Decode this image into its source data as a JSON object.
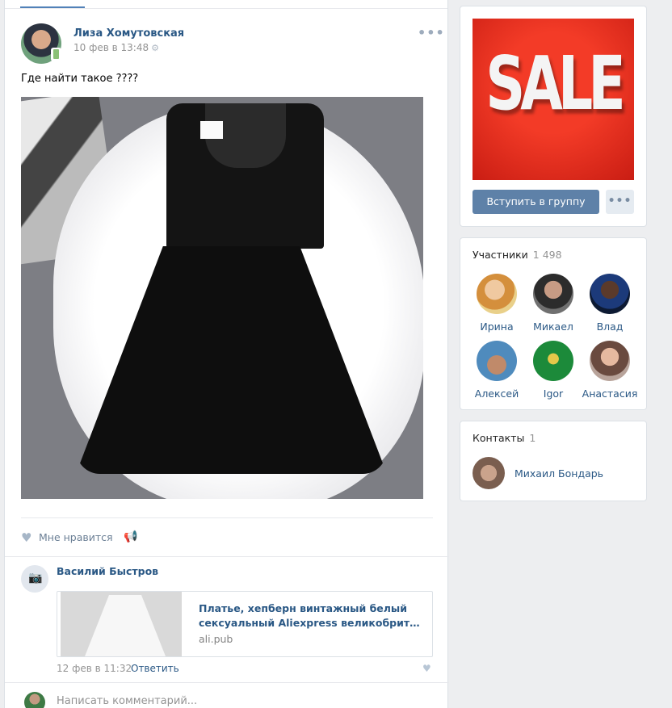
{
  "post": {
    "author": "Лиза Хомутовская",
    "date": "10 фев в 13:48",
    "text": "Где найти такое ????",
    "like_label": "Мне нравится"
  },
  "comment": {
    "author": "Василий Быстров",
    "link_title_line1": "Платье, хепберн винтажный белый",
    "link_title_line2": "сексуальный Aliexpress великобритании лет...",
    "link_domain": "ali.pub",
    "date": "12 фев в 11:32",
    "reply_label": "Ответить",
    "write_placeholder": "Написать комментарий..."
  },
  "group": {
    "cover_text": "SALE",
    "join_label": "Вступить в группу",
    "more_label": "•••"
  },
  "members": {
    "title": "Участники",
    "count": "1 498",
    "items": [
      {
        "name": "Ирина"
      },
      {
        "name": "Микаел"
      },
      {
        "name": "Влад"
      },
      {
        "name": "Алексей"
      },
      {
        "name": "Igor"
      },
      {
        "name": "Анастасия"
      }
    ]
  },
  "contacts": {
    "title": "Контакты",
    "count": "1",
    "items": [
      {
        "name": "Михаил Бондарь"
      }
    ]
  },
  "colors": {
    "link": "#2a5885",
    "button": "#5e81a8",
    "sale_red": "#e12c1d",
    "background": "#edeef0"
  }
}
